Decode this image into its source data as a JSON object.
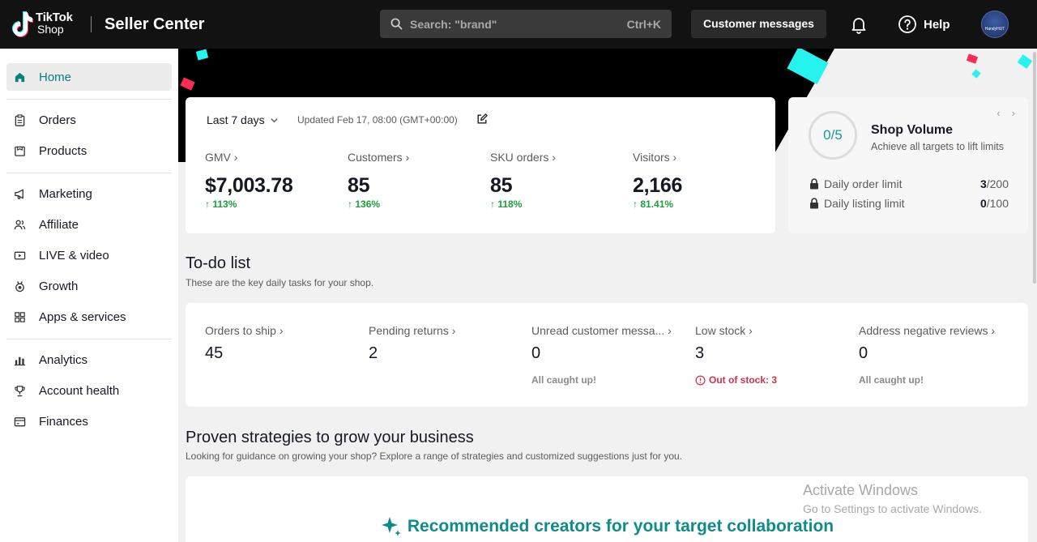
{
  "header": {
    "logo_brand": "TikTok",
    "logo_sub": "Shop",
    "app_name": "Seller Center",
    "search_placeholder": "Search: \"brand\"",
    "search_shortcut": "Ctrl+K",
    "customer_messages": "Customer messages",
    "help": "Help",
    "avatar_text": "HandyHUT"
  },
  "sidebar": {
    "items": [
      {
        "label": "Home",
        "icon": "home-icon",
        "active": true
      },
      {
        "label": "Orders",
        "icon": "clipboard-icon"
      },
      {
        "label": "Products",
        "icon": "box-icon"
      },
      {
        "label": "Marketing",
        "icon": "megaphone-icon"
      },
      {
        "label": "Affiliate",
        "icon": "people-icon"
      },
      {
        "label": "LIVE & video",
        "icon": "video-icon"
      },
      {
        "label": "Growth",
        "icon": "medal-icon"
      },
      {
        "label": "Apps & services",
        "icon": "apps-grid-icon"
      },
      {
        "label": "Analytics",
        "icon": "bar-chart-icon"
      },
      {
        "label": "Account health",
        "icon": "trophy-icon"
      },
      {
        "label": "Finances",
        "icon": "wallet-icon"
      }
    ]
  },
  "metrics": {
    "range": "Last 7 days",
    "updated": "Updated Feb 17, 08:00 (GMT+00:00)",
    "items": [
      {
        "label": "GMV",
        "value": "$7,003.78",
        "change": "113%"
      },
      {
        "label": "Customers",
        "value": "85",
        "change": "136%"
      },
      {
        "label": "SKU orders",
        "value": "85",
        "change": "118%"
      },
      {
        "label": "Visitors",
        "value": "2,166",
        "change": "81.41%"
      }
    ]
  },
  "shop_volume": {
    "progress": "0/5",
    "title": "Shop Volume",
    "subtitle": "Achieve all targets to lift limits",
    "limits": [
      {
        "label": "Daily order limit",
        "current": "3",
        "max": "/200"
      },
      {
        "label": "Daily listing limit",
        "current": "0",
        "max": "/100"
      }
    ]
  },
  "todo": {
    "title": "To-do list",
    "subtitle": "These are the key daily tasks for your shop.",
    "items": [
      {
        "label": "Orders to ship",
        "value": "45",
        "note": ""
      },
      {
        "label": "Pending returns",
        "value": "2",
        "note": ""
      },
      {
        "label": "Unread customer messa...",
        "value": "0",
        "note": "All caught up!"
      },
      {
        "label": "Low stock",
        "value": "3",
        "note": "Out of stock: 3"
      },
      {
        "label": "Address negative reviews",
        "value": "0",
        "note": "All caught up!"
      }
    ]
  },
  "strategies": {
    "title": "Proven strategies to grow your business",
    "subtitle": "Looking for guidance on growing your shop? Explore a range of strategies and customized suggestions just for you.",
    "card_title": "Recommended creators for your target collaboration"
  },
  "watermark": {
    "line1": "Activate Windows",
    "line2": "Go to Settings to activate Windows."
  },
  "colors": {
    "accent": "#08807e",
    "positive": "#1b9e3c",
    "alert": "#d0314a",
    "topbar": "#121212"
  }
}
